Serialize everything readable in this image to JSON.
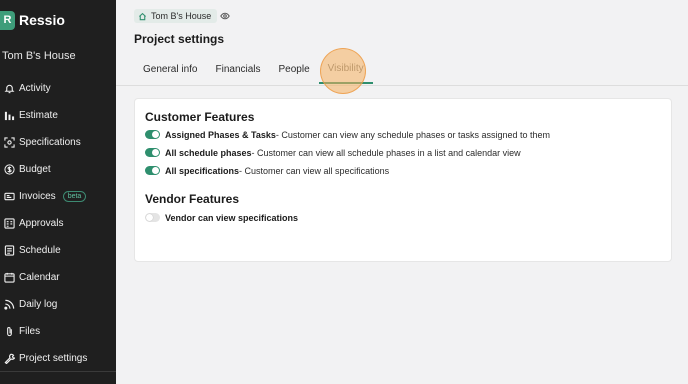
{
  "brand": {
    "logo_letter": "R",
    "name": "Ressio"
  },
  "sidebar": {
    "project_name": "Tom B's House",
    "items": [
      {
        "label": "Activity",
        "icon": "bell-icon"
      },
      {
        "label": "Estimate",
        "icon": "bar-chart-icon"
      },
      {
        "label": "Specifications",
        "icon": "scan-icon"
      },
      {
        "label": "Budget",
        "icon": "dollar-icon"
      },
      {
        "label": "Invoices",
        "icon": "invoice-icon",
        "badge": "beta"
      },
      {
        "label": "Approvals",
        "icon": "approvals-icon"
      },
      {
        "label": "Schedule",
        "icon": "schedule-icon"
      },
      {
        "label": "Calendar",
        "icon": "calendar-icon"
      },
      {
        "label": "Daily log",
        "icon": "rss-icon"
      },
      {
        "label": "Files",
        "icon": "paperclip-icon"
      },
      {
        "label": "Project settings",
        "icon": "wrench-icon"
      }
    ]
  },
  "header": {
    "breadcrumb": "Tom B's House",
    "page_title": "Project settings"
  },
  "tabs": [
    {
      "label": "General info",
      "active": false
    },
    {
      "label": "Financials",
      "active": false
    },
    {
      "label": "People",
      "active": false
    },
    {
      "label": "Visibility",
      "active": true
    }
  ],
  "customer_features": {
    "title": "Customer Features",
    "items": [
      {
        "name": "Assigned Phases & Tasks",
        "description": "- Customer can view any schedule phases or tasks assigned to them",
        "enabled": true
      },
      {
        "name": "All schedule phases",
        "description": "- Customer can view all schedule phases in a list and calendar view",
        "enabled": true
      },
      {
        "name": "All specifications",
        "description": "- Customer can view all specifications",
        "enabled": true
      }
    ]
  },
  "vendor_features": {
    "title": "Vendor Features",
    "items": [
      {
        "name": "Vendor can view specifications",
        "description": "",
        "enabled": false
      }
    ]
  },
  "colors": {
    "accent": "#2f8f6e",
    "sidebar_bg": "#1f1f1f",
    "page_bg": "#f2f2f3"
  }
}
